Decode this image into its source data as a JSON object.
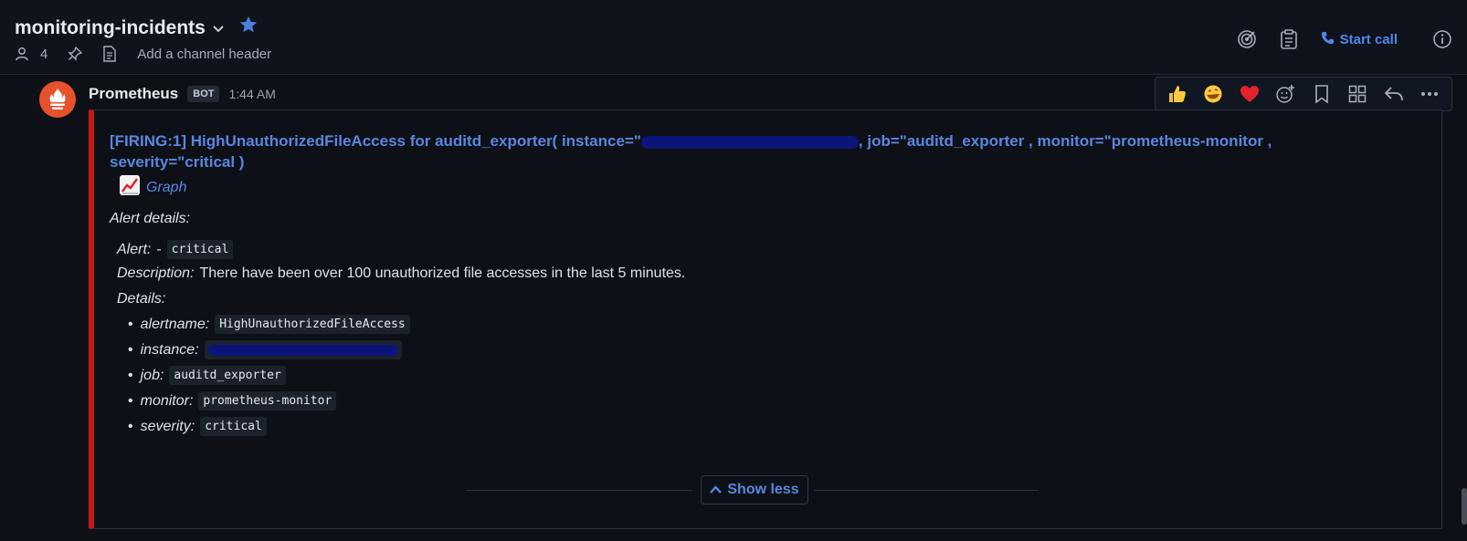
{
  "channel": {
    "name": "monitoring-incidents",
    "member_count": "4",
    "header_placeholder": "Add a channel header",
    "start_call_label": "Start call"
  },
  "message": {
    "author": "Prometheus",
    "badge": "BOT",
    "time": "1:44 AM",
    "attachment": {
      "border_color": "#c41a17",
      "title_part1": "[FIRING:1] HighUnauthorizedFileAccess for auditd_exporter( instance=\"",
      "title_part2": ", job=\"auditd_exporter , monitor=\"prometheus-monitor ,",
      "title_part3": "severity=\"critical )",
      "graph_label": "Graph",
      "alert_details_label": "Alert details",
      "alert_label": "Alert:",
      "alert_dash": "-",
      "alert_value": "critical",
      "description_label": "Description:",
      "description_value": "There have been over 100 unauthorized file accesses in the last 5 minutes.",
      "details_label": "Details:",
      "details": [
        {
          "key": "alertname:",
          "value": "HighUnauthorizedFileAccess"
        },
        {
          "key": "instance:",
          "value": ""
        },
        {
          "key": "job:",
          "value": "auditd_exporter"
        },
        {
          "key": "monitor:",
          "value": "prometheus-monitor"
        },
        {
          "key": "severity:",
          "value": "critical"
        }
      ],
      "show_less_label": "Show less"
    }
  },
  "hover_actions": [
    "thumbsup-icon",
    "rofl-icon",
    "heart-icon",
    "add-reaction-icon",
    "bookmark-icon",
    "apps-icon",
    "reply-icon",
    "more-icon"
  ],
  "colors": {
    "accent": "#4f86ea",
    "alert_red": "#c41a17",
    "link": "#5b85e0"
  }
}
